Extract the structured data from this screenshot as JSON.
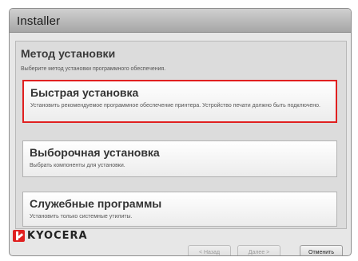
{
  "window": {
    "title": "Installer"
  },
  "panel": {
    "title": "Метод установки",
    "subtitle": "Выберите метод установки программного обеспечения."
  },
  "options": [
    {
      "title": "Быстрая установка",
      "description": "Установить рекомендуемое программное обеспечение принтера. Устройство печати должно быть подключено.",
      "selected": true
    },
    {
      "title": "Выборочная установка",
      "description": "Выбрать компоненты для установки.",
      "selected": false
    },
    {
      "title": "Служебные программы",
      "description": "Установить только системные утилиты.",
      "selected": false
    }
  ],
  "footer": {
    "logo_text": "KYOCERA",
    "back_label": "< Назад",
    "next_label": "Далее >",
    "cancel_label": "Отменить"
  },
  "colors": {
    "selection_border": "#e02020",
    "brand_red": "#e02020"
  }
}
